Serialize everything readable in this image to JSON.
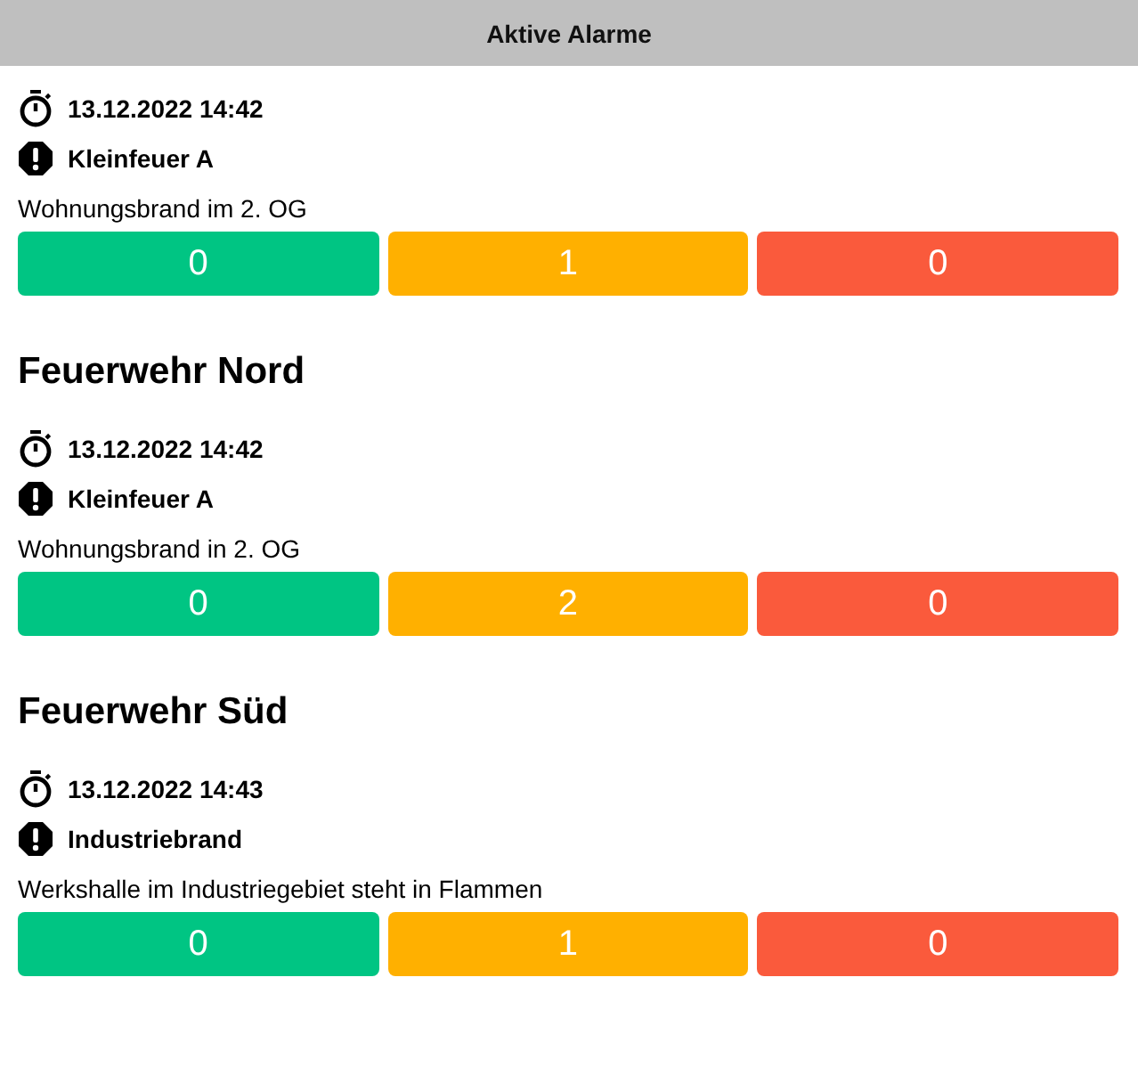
{
  "header": {
    "title": "Aktive Alarme"
  },
  "alarms": [
    {
      "time": "13.12.2022 14:42",
      "keyword": "Kleinfeuer A",
      "description": "Wohnungsbrand im 2. OG",
      "counts": [
        {
          "value": "0",
          "color": "#00c583"
        },
        {
          "value": "1",
          "color": "#ffb000"
        },
        {
          "value": "0",
          "color": "#fa5a3c"
        }
      ]
    },
    {
      "unit": "Feuerwehr Nord",
      "time": "13.12.2022 14:42",
      "keyword": "Kleinfeuer A",
      "description": "Wohnungsbrand in 2. OG",
      "counts": [
        {
          "value": "0",
          "color": "#00c583"
        },
        {
          "value": "2",
          "color": "#ffb000"
        },
        {
          "value": "0",
          "color": "#fa5a3c"
        }
      ]
    },
    {
      "unit": "Feuerwehr Süd",
      "time": "13.12.2022 14:43",
      "keyword": "Industriebrand",
      "description": "Werkshalle im Industriegebiet steht in Flammen",
      "counts": [
        {
          "value": "0",
          "color": "#00c583"
        },
        {
          "value": "1",
          "color": "#ffb000"
        },
        {
          "value": "0",
          "color": "#fa5a3c"
        }
      ]
    }
  ]
}
